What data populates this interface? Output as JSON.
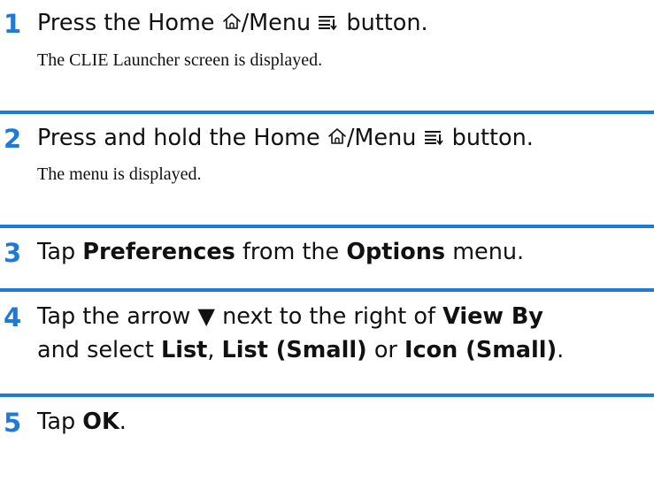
{
  "steps": [
    {
      "number": "1",
      "line1": {
        "part1": "Press the Home",
        "part2": "/Menu",
        "part3": "button."
      },
      "note": "The CLIE Launcher screen is displayed."
    },
    {
      "number": "2",
      "line1": {
        "part1": "Press and hold the Home",
        "part2": "/Menu",
        "part3": "button."
      },
      "note": "The menu is displayed."
    },
    {
      "number": "3",
      "line1": {
        "t1": "Tap",
        "b1": "Preferences",
        "t2": "from the",
        "b2": "Options",
        "t3": "menu."
      }
    },
    {
      "number": "4",
      "line1": {
        "t1": "Tap the arrow",
        "arrow": "▼",
        "t2": "next to the right of",
        "b1": "View By"
      },
      "line2": {
        "t1": "and select",
        "b1": "List",
        "t2": ",",
        "b2": "List (Small)",
        "t3": "or",
        "b3": "Icon (Small)",
        "t4": "."
      }
    },
    {
      "number": "5",
      "line1": {
        "t1": "Tap",
        "b1": "OK",
        "t2": "."
      }
    }
  ],
  "icons": {
    "home": "home-icon",
    "menu": "menu-icon"
  },
  "colors": {
    "accent": "#1f7ad6",
    "text": "#111111"
  }
}
